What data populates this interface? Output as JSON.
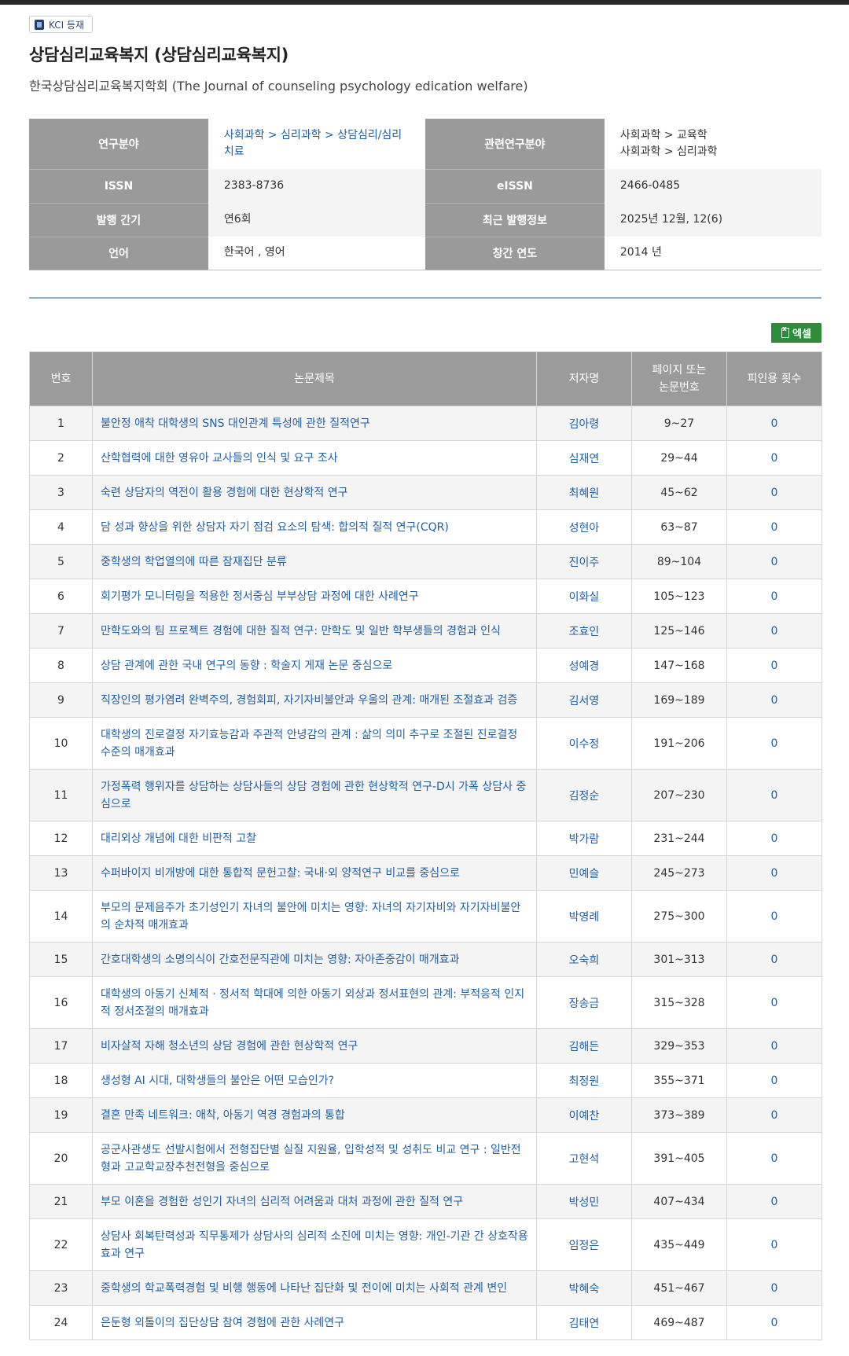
{
  "badge": {
    "label": "KCI 등재"
  },
  "journal": {
    "title": "상담심리교육복지 (상담심리교육복지)",
    "publisher": "한국상담심리교육복지학회 (The Journal of counseling psychology edication welfare)"
  },
  "info": {
    "field_label": "연구분야",
    "field_value": "사회과학 > 심리과학 > 상담심리/심리치료",
    "related_label": "관련연구분야",
    "related_value_1": "사회과학 > 교육학",
    "related_value_2": "사회과학 > 심리과학",
    "issn_label": "ISSN",
    "issn_value": "2383-8736",
    "eissn_label": "eISSN",
    "eissn_value": "2466-0485",
    "freq_label": "발행 간기",
    "freq_value": "연6회",
    "recent_label": "최근 발행정보",
    "recent_value": "2025년 12월, 12(6)",
    "lang_label": "언어",
    "lang_value": "한국어 , 영어",
    "founded_label": "창간 연도",
    "founded_value": "2014 년"
  },
  "excel_button": {
    "label": "엑셀",
    "icon": "excel-file-icon"
  },
  "table": {
    "headers": {
      "no": "번호",
      "title": "논문제목",
      "author": "저자명",
      "pages_line1": "페이지 또는",
      "pages_line2": "논문번호",
      "cited": "피인용 횟수"
    },
    "rows": [
      {
        "no": "1",
        "title": "불안정 애착 대학생의 SNS 대인관계 특성에 관한 질적연구",
        "author": "김아령",
        "pages": "9~27",
        "cited": "0"
      },
      {
        "no": "2",
        "title": "산학협력에 대한 영유아 교사들의 인식 및 요구 조사",
        "author": "심재연",
        "pages": "29~44",
        "cited": "0"
      },
      {
        "no": "3",
        "title": "숙련 상담자의 역전이 활용 경험에 대한 현상학적 연구",
        "author": "최혜원",
        "pages": "45~62",
        "cited": "0"
      },
      {
        "no": "4",
        "title": "담 성과 향상을 위한 상담자 자기 점검 요소의 탐색: 합의적 질적 연구(CQR)",
        "author": "성현아",
        "pages": "63~87",
        "cited": "0"
      },
      {
        "no": "5",
        "title": "중학생의 학업열의에 따른 잠재집단 분류",
        "author": "진이주",
        "pages": "89~104",
        "cited": "0"
      },
      {
        "no": "6",
        "title": "회기평가 모니터링을 적용한 정서중심 부부상담 과정에 대한 사례연구",
        "author": "이화실",
        "pages": "105~123",
        "cited": "0"
      },
      {
        "no": "7",
        "title": "만학도와의 팀 프로젝트 경험에 대한 질적 연구: 만학도 및 일반 학부생들의 경험과 인식",
        "author": "조효인",
        "pages": "125~146",
        "cited": "0"
      },
      {
        "no": "8",
        "title": "상담 관계에 관한 국내 연구의 동향 : 학술지 게재 논문 중심으로",
        "author": "성예경",
        "pages": "147~168",
        "cited": "0"
      },
      {
        "no": "9",
        "title": "직장인의 평가염려 완벽주의, 경험회피, 자기자비불안과 우울의 관계: 매개된 조절효과 검증",
        "author": "김서영",
        "pages": "169~189",
        "cited": "0"
      },
      {
        "no": "10",
        "title": "대학생의 진로결정 자기효능감과 주관적 안녕감의 관계 : 삶의 의미 추구로 조절된 진로결정 수준의 매개효과",
        "author": "이수정",
        "pages": "191~206",
        "cited": "0"
      },
      {
        "no": "11",
        "title": "가정폭력 행위자를 상담하는 상담사들의 상담 경험에 관한 현상학적 연구-D시 가폭 상담사 중심으로",
        "author": "김정순",
        "pages": "207~230",
        "cited": "0"
      },
      {
        "no": "12",
        "title": "대리외상 개념에 대한 비판적 고찰",
        "author": "박가람",
        "pages": "231~244",
        "cited": "0"
      },
      {
        "no": "13",
        "title": "수퍼바이지 비개방에 대한 통합적 문헌고찰: 국내·외 양적연구 비교를 중심으로",
        "author": "민예슬",
        "pages": "245~273",
        "cited": "0"
      },
      {
        "no": "14",
        "title": "부모의 문제음주가 초기성인기 자녀의 불안에 미치는 영향: 자녀의 자기자비와 자기자비불안의 순차적 매개효과",
        "author": "박영례",
        "pages": "275~300",
        "cited": "0"
      },
      {
        "no": "15",
        "title": "간호대학생의 소명의식이 간호전문직관에 미치는 영향: 자아존중감이 매개효과",
        "author": "오숙희",
        "pages": "301~313",
        "cited": "0"
      },
      {
        "no": "16",
        "title": "대학생의 아동기 신체적 · 정서적 학대에 의한 아동기 외상과 정서표현의 관계: 부적응적 인지적 정서조절의 매개효과",
        "author": "장송금",
        "pages": "315~328",
        "cited": "0"
      },
      {
        "no": "17",
        "title": "비자살적 자해 청소년의 상담 경험에 관한 현상학적 연구",
        "author": "김해든",
        "pages": "329~353",
        "cited": "0"
      },
      {
        "no": "18",
        "title": "생성형 AI 시대, 대학생들의 불안은 어떤 모습인가?",
        "author": "최정원",
        "pages": "355~371",
        "cited": "0"
      },
      {
        "no": "19",
        "title": "결혼 만족 네트워크: 애착, 아동기 역경 경험과의 통합",
        "author": "이예찬",
        "pages": "373~389",
        "cited": "0"
      },
      {
        "no": "20",
        "title": "공군사관생도 선발시험에서 전형집단별 실질 지원율, 입학성적 및 성취도 비교 연구 : 일반전형과 고교학교장추천전형을 중심으로",
        "author": "고현석",
        "pages": "391~405",
        "cited": "0"
      },
      {
        "no": "21",
        "title": "부모 이혼을 경험한 성인기 자녀의 심리적 어려움과 대처 과정에 관한 질적 연구",
        "author": "박성민",
        "pages": "407~434",
        "cited": "0"
      },
      {
        "no": "22",
        "title": "상담사 회복탄력성과 직무통제가 상담사의 심리적 소진에 미치는 영향: 개인-기관 간 상호작용 효과 연구",
        "author": "임정은",
        "pages": "435~449",
        "cited": "0"
      },
      {
        "no": "23",
        "title": "중학생의 학교폭력경험 및 비행 행동에 나타난 집단화 및 전이에 미치는 사회적 관계 변인",
        "author": "박혜숙",
        "pages": "451~467",
        "cited": "0"
      },
      {
        "no": "24",
        "title": "은둔형 외톨이의 집단상담 참여 경험에 관한 사례연구",
        "author": "김태연",
        "pages": "469~487",
        "cited": "0"
      }
    ]
  }
}
